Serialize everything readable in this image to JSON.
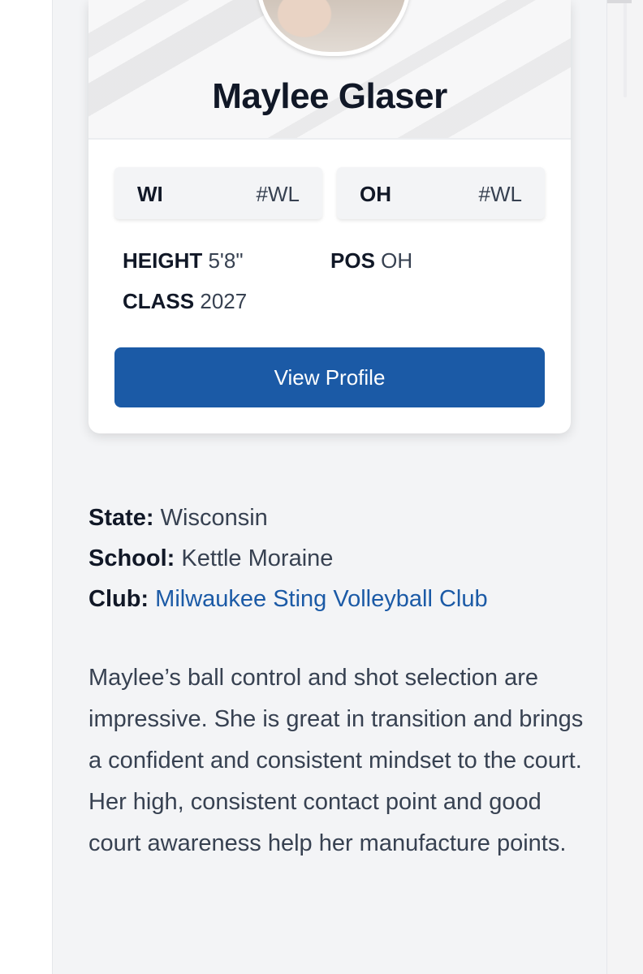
{
  "profile": {
    "name": "Maylee Glaser",
    "tags": [
      {
        "key": "WI",
        "value": "#WL"
      },
      {
        "key": "OH",
        "value": "#WL"
      }
    ],
    "stats": {
      "height_label": "HEIGHT",
      "height_value": "5'8\"",
      "pos_label": "POS",
      "pos_value": "OH",
      "class_label": "CLASS",
      "class_value": "2027"
    },
    "view_profile_label": "View Profile"
  },
  "details": {
    "state_label": "State:",
    "state_value": "Wisconsin",
    "school_label": "School:",
    "school_value": "Kettle Moraine",
    "club_label": "Club:",
    "club_value": "Milwaukee Sting Volleyball Club"
  },
  "bio": "Maylee’s ball control and shot selection are impressive. She is great in transition and brings a confident and consistent mindset to the court. Her high, consistent contact point and good court awareness help her manufacture points.",
  "colors": {
    "accent": "#1b5aa6",
    "panel_bg": "#f3f4f6",
    "heading": "#111827"
  }
}
